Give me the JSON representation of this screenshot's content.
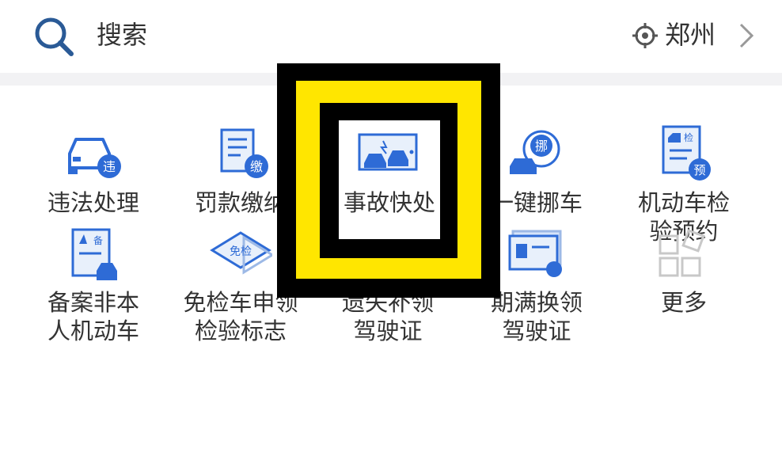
{
  "header": {
    "search_label": "搜索",
    "city": "郑州",
    "icons": {
      "search": "search-icon",
      "location": "location-target-icon",
      "chevron": "chevron-right-icon"
    }
  },
  "services": [
    {
      "label": "违法处理",
      "icon": "car-violation-icon"
    },
    {
      "label": "罚款缴纳",
      "icon": "scroll-payment-icon"
    },
    {
      "label": "事故快处",
      "icon": "accident-quick-handle-icon"
    },
    {
      "label": "一键挪车",
      "icon": "move-car-icon"
    },
    {
      "label": "机动车检\n验预约",
      "icon": "vehicle-inspection-icon"
    },
    {
      "label": "备案非本\n人机动车",
      "icon": "vehicle-filing-icon"
    },
    {
      "label": "免检车申领\n检验标志",
      "icon": "exempt-inspection-icon"
    },
    {
      "label": "遗失补领\n驾驶证",
      "icon": "license-reissue-icon"
    },
    {
      "label": "期满换领\n驾驶证",
      "icon": "license-renewal-icon"
    },
    {
      "label": "更多",
      "icon": "more-grid-icon"
    }
  ],
  "colors": {
    "accent": "#2e6bd6",
    "highlight_yellow": "#ffe600",
    "text": "#333333"
  }
}
